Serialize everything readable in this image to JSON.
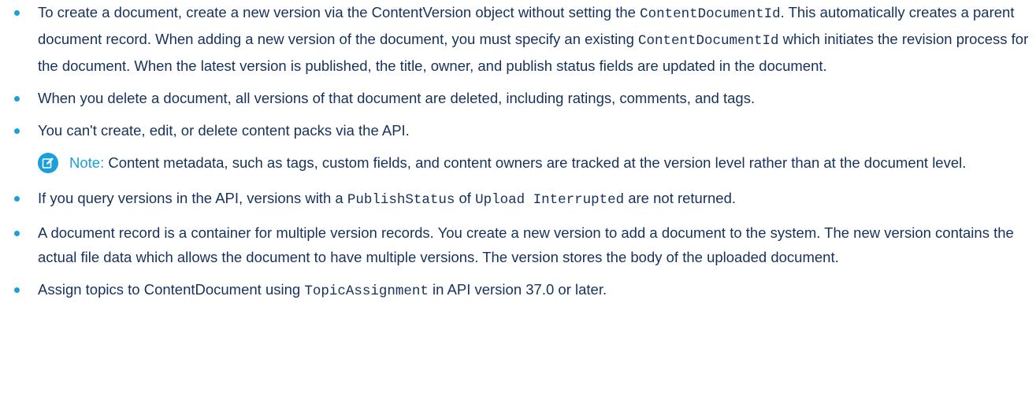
{
  "items": [
    {
      "t1": "To create a document, create a new version via the ContentVersion object without setting the ",
      "c1": "ContentDocumentId",
      "t2": ". This automatically creates a parent document record. When adding a new version of the document, you must specify an existing ",
      "c2": "ContentDocumentId",
      "t3": " which initiates the revision process for the document. When the latest version is published, the title, owner, and publish status fields are updated in the document."
    },
    {
      "t1": "When you delete a document, all versions of that document are deleted, including ratings, comments, and tags."
    },
    {
      "t1": "You can't create, edit, or delete content packs via the API."
    },
    {
      "t1": "If you query versions in the API, versions with a ",
      "c1": "PublishStatus",
      "t2": " of ",
      "c2": "Upload Interrupted",
      "t3": " are not returned."
    },
    {
      "t1": "A document record is a container for multiple version records. You create a new version to add a document to the system. The new version contains the actual file data which allows the document to have multiple versions. The version stores the body of the uploaded document."
    },
    {
      "t1": "Assign topics to ContentDocument using ",
      "c1": "TopicAssignment",
      "t2": " in API version 37.0 or later."
    }
  ],
  "note": {
    "label": "Note:",
    "text": "Content metadata, such as tags, custom fields, and content owners are tracked at the version level rather than at the document level.",
    "icon": "edit-note-icon"
  },
  "colors": {
    "accent": "#1a9fdb",
    "text": "#16325c"
  }
}
